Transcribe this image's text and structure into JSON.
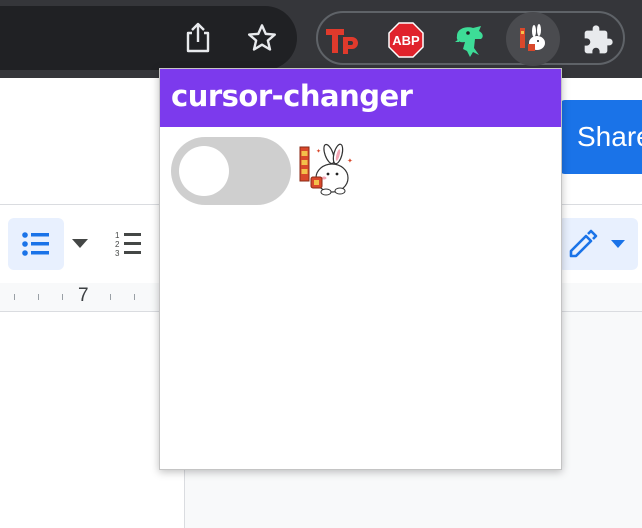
{
  "popup": {
    "title": "cursor-changer",
    "toggle_on": false
  },
  "toolbar": {
    "share_icon": "share-icon",
    "bookmark_icon": "star-icon",
    "extensions": [
      {
        "name": "tp-extension-icon",
        "label": "Tp"
      },
      {
        "name": "adblock-plus-icon",
        "label": "ABP"
      },
      {
        "name": "ghost-dino-extension-icon",
        "label": ""
      },
      {
        "name": "cursor-changer-extension-icon",
        "label": ""
      },
      {
        "name": "extensions-puzzle-icon",
        "label": ""
      }
    ]
  },
  "docs": {
    "share_label": "Share",
    "ruler_number": "7"
  },
  "colors": {
    "popup_header": "#7c3aed",
    "share": "#1a73e8",
    "abp_red": "#e0232c",
    "tp_red": "#e03a2c",
    "dino_green": "#3ddc97"
  }
}
